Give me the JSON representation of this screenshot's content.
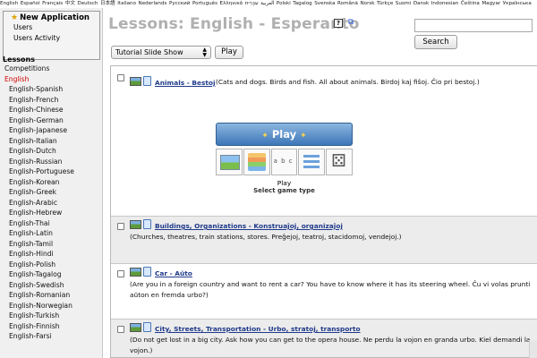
{
  "language_bar": [
    "English",
    "Español",
    "Français",
    "中文",
    "Deutsch",
    "日本語",
    "Italiano",
    "Nederlands",
    "Русский",
    "Português",
    "Ελληνικά",
    "العربية",
    "עִבְרִית",
    "Polski",
    "Tagalog",
    "Svenska",
    "Română",
    "Norsk",
    "Türkçe",
    "Suomi",
    "Dansk",
    "Indonesian",
    "Čeština",
    "Magyar",
    "Українська"
  ],
  "sidebar": {
    "new_app_title": "New Application",
    "new_app_links": [
      "Users",
      "Users Activity"
    ],
    "lessons_heading": "Lessons",
    "items": [
      {
        "label": "Competitions",
        "active": false,
        "sub": false
      },
      {
        "label": "English",
        "active": true,
        "sub": false
      },
      {
        "label": "English-Spanish",
        "active": false,
        "sub": true
      },
      {
        "label": "English-French",
        "active": false,
        "sub": true
      },
      {
        "label": "English-Chinese",
        "active": false,
        "sub": true
      },
      {
        "label": "English-German",
        "active": false,
        "sub": true
      },
      {
        "label": "English-Japanese",
        "active": false,
        "sub": true
      },
      {
        "label": "English-Italian",
        "active": false,
        "sub": true
      },
      {
        "label": "English-Dutch",
        "active": false,
        "sub": true
      },
      {
        "label": "English-Russian",
        "active": false,
        "sub": true
      },
      {
        "label": "English-Portuguese",
        "active": false,
        "sub": true
      },
      {
        "label": "English-Korean",
        "active": false,
        "sub": true
      },
      {
        "label": "English-Greek",
        "active": false,
        "sub": true
      },
      {
        "label": "English-Arabic",
        "active": false,
        "sub": true
      },
      {
        "label": "English-Hebrew",
        "active": false,
        "sub": true
      },
      {
        "label": "English-Thai",
        "active": false,
        "sub": true
      },
      {
        "label": "English-Latin",
        "active": false,
        "sub": true
      },
      {
        "label": "English-Tamil",
        "active": false,
        "sub": true
      },
      {
        "label": "English-Hindi",
        "active": false,
        "sub": true
      },
      {
        "label": "English-Polish",
        "active": false,
        "sub": true
      },
      {
        "label": "English-Tagalog",
        "active": false,
        "sub": true
      },
      {
        "label": "English-Swedish",
        "active": false,
        "sub": true
      },
      {
        "label": "English-Romanian",
        "active": false,
        "sub": true
      },
      {
        "label": "English-Norwegian",
        "active": false,
        "sub": true
      },
      {
        "label": "English-Turkish",
        "active": false,
        "sub": true
      },
      {
        "label": "English-Finnish",
        "active": false,
        "sub": true
      },
      {
        "label": "English-Farsi",
        "active": false,
        "sub": true
      }
    ]
  },
  "header": {
    "title": "Lessons: English - Esperanto",
    "help_icon": "help-icon",
    "external_icon": "external-link-icon"
  },
  "search": {
    "value": "",
    "button_label": "Search"
  },
  "toolbar": {
    "mode_selected": "Tutorial Slide Show",
    "play_label": "Play"
  },
  "play_widget": {
    "button_label": "Play",
    "icons": [
      "picture-game-icon",
      "cards-game-icon",
      "letters-game-icon",
      "list-game-icon",
      "dice-game-icon"
    ],
    "caption": "Play",
    "subcaption": "Select game type"
  },
  "lessons": [
    {
      "title": "Animals - Bestoj",
      "description": "(Cats and dogs. Birds and fish. All about animals. Birdoj kaj fiŝoj. Ĉio pri bestoj.)"
    },
    {
      "title": "Buildings, Organizations - Konstruaĵoj, organizaĵoj",
      "description": "(Churches, theatres, train stations, stores. Preĝejoj, teatroj, stacidomoj, vendejoj.)"
    },
    {
      "title": "Car - Aŭto",
      "description": "(Are you in a foreign country and want to rent a car? You have to know where it has its steering wheel. Ĉu vi volas prunti aŭton en fremda urbo?)"
    },
    {
      "title": "City, Streets, Transportation - Urbo, stratoj, transporto",
      "description": "(Do not get lost in a big city. Ask how you can get to the opera house. Ne perdu la vojon en granda urbo. Kiel demandi la vojon.)"
    }
  ],
  "colors": {
    "title_gray": "#b0b0b0",
    "link_blue": "#1f3a8a",
    "active_red": "#d00000",
    "play_blue": "#3d76b8"
  }
}
